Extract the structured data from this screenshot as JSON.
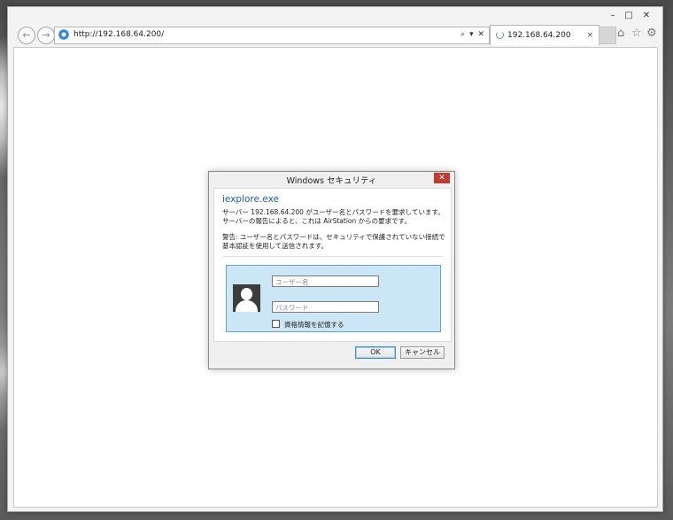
{
  "browser": {
    "window_controls": {
      "minimize": "–",
      "maximize": "□",
      "close": "✕"
    },
    "nav": {
      "back_icon": "←",
      "forward_icon": "→"
    },
    "address": {
      "url": "http://192.168.64.200/",
      "actions": "⌕ ▾ ✕"
    },
    "tab": {
      "title": "192.168.64.200",
      "close": "×"
    },
    "tools": {
      "home": "⌂",
      "favorites": "☆",
      "settings": "⚙"
    }
  },
  "dialog": {
    "title": "Windows セキュリティ",
    "close": "✕",
    "app_name": "iexplore.exe",
    "message": "サーバー 192.168.64.200 がユーザー名とパスワードを要求しています。サーバーの報告によると、これは AirStation からの要求です。",
    "warning": "警告: ユーザー名とパスワードは、セキュリティで保護されていない接続で基本認証を使用して送信されます。",
    "username_placeholder": "ユーザー名",
    "password_placeholder": "パスワード",
    "remember_label": "資格情報を記憶する",
    "ok_label": "OK",
    "cancel_label": "キャンセル"
  }
}
